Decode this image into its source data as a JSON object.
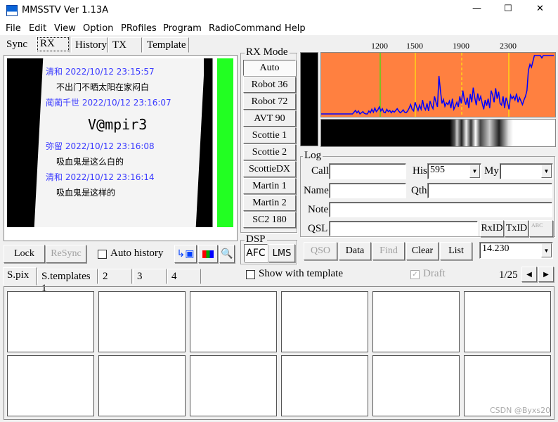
{
  "window": {
    "title": "MMSSTV Ver 1.13A",
    "min": "—",
    "max": "☐",
    "close": "✕"
  },
  "menu": [
    "File",
    "Edit",
    "View",
    "Option",
    "PRofiles",
    "Program",
    "RadioCommand",
    "Help"
  ],
  "top_tabs": [
    "Sync",
    "RX",
    "History",
    "TX",
    "Template"
  ],
  "rx_image": {
    "lines": [
      {
        "text": "清和 2022/10/12 23:15:57",
        "color": "#3a3aff"
      },
      {
        "text": "不出门不晒太阳在家闷白",
        "color": "#000"
      },
      {
        "text": "蔺蔺千世 2022/10/12 23:16:07",
        "color": "#3a3aff"
      },
      {
        "text": "V@mpir3",
        "color": "#000"
      },
      {
        "text": "弥留 2022/10/12 23:16:08",
        "color": "#3a3aff"
      },
      {
        "text": "吸血鬼是这么白的",
        "color": "#000"
      },
      {
        "text": "清和 2022/10/12 23:16:14",
        "color": "#3a3aff"
      },
      {
        "text": "吸血鬼是这样的",
        "color": "#000"
      }
    ]
  },
  "rx_controls": {
    "lock": "Lock",
    "resync": "ReSync",
    "auto_history": "Auto history",
    "auto_history_checked": false
  },
  "rx_mode": {
    "title": "RX Mode",
    "selected": "Auto",
    "modes": [
      "Auto",
      "Robot 36",
      "Robot 72",
      "AVT 90",
      "Scottie 1",
      "Scottie 2",
      "ScottieDX",
      "Martin 1",
      "Martin 2",
      "SC2 180"
    ]
  },
  "dsp": {
    "title": "DSP",
    "afc": "AFC",
    "lms": "LMS"
  },
  "spectrum": {
    "freq_labels": [
      "1200",
      "1500",
      "1900",
      "2300"
    ],
    "bg_color": "#ff8040",
    "trace_color": "#0000ff",
    "levels": [
      0,
      0,
      0,
      0,
      0,
      0,
      0,
      0,
      0,
      0,
      0,
      0,
      0,
      0,
      0,
      0,
      0,
      0,
      0,
      0,
      0,
      0,
      3,
      6,
      2,
      5,
      0,
      2,
      4,
      1,
      0,
      0,
      5,
      2,
      8,
      3,
      10,
      4,
      7,
      12,
      5,
      9,
      3,
      2,
      8,
      4,
      6,
      2,
      5,
      3,
      6,
      9,
      5,
      2,
      4,
      7,
      3,
      2,
      5,
      10,
      16,
      8,
      5,
      20,
      12,
      6,
      15,
      8,
      24,
      11,
      7,
      18,
      5,
      22,
      14,
      9,
      30,
      20,
      12,
      65,
      40,
      18,
      25,
      13,
      19,
      16,
      22,
      10,
      26,
      8,
      14,
      20,
      12,
      30,
      18,
      40,
      25,
      16,
      28,
      10,
      34,
      20,
      45,
      28,
      15,
      35,
      22,
      30,
      18,
      8,
      24,
      14,
      26,
      10,
      40,
      32,
      20,
      44,
      26,
      38,
      18,
      15,
      30,
      10,
      28,
      20,
      8,
      32,
      26,
      30,
      24,
      35,
      20,
      28,
      22,
      16,
      24,
      30,
      40,
      75,
      85,
      80,
      90,
      100,
      100,
      100,
      100,
      100,
      96,
      100,
      100,
      100,
      100,
      100,
      100,
      100,
      100
    ]
  },
  "log": {
    "title": "Log",
    "call_label": "Call",
    "call": "",
    "his_label": "His",
    "his": "595",
    "my_label": "My",
    "my": "",
    "name_label": "Name",
    "name": "",
    "qth_label": "Qth",
    "qth": "",
    "note_label": "Note",
    "note": "",
    "qsl_label": "QSL",
    "qsl": "",
    "rxid": "RxID",
    "txid": "TxID",
    "abc": "ABC"
  },
  "log_buttons": {
    "qso": "QSO",
    "data": "Data",
    "find": "Find",
    "clear": "Clear",
    "list": "List",
    "freq": "14.230"
  },
  "bottom_tabs": [
    "S.pix",
    "S.templates 1",
    "2",
    "3",
    "4"
  ],
  "template_bar": {
    "show_with_template": "Show with template",
    "draft": "Draft",
    "draft_checked": true,
    "page": "1/25"
  },
  "watermark": "CSDN @Byxs20"
}
